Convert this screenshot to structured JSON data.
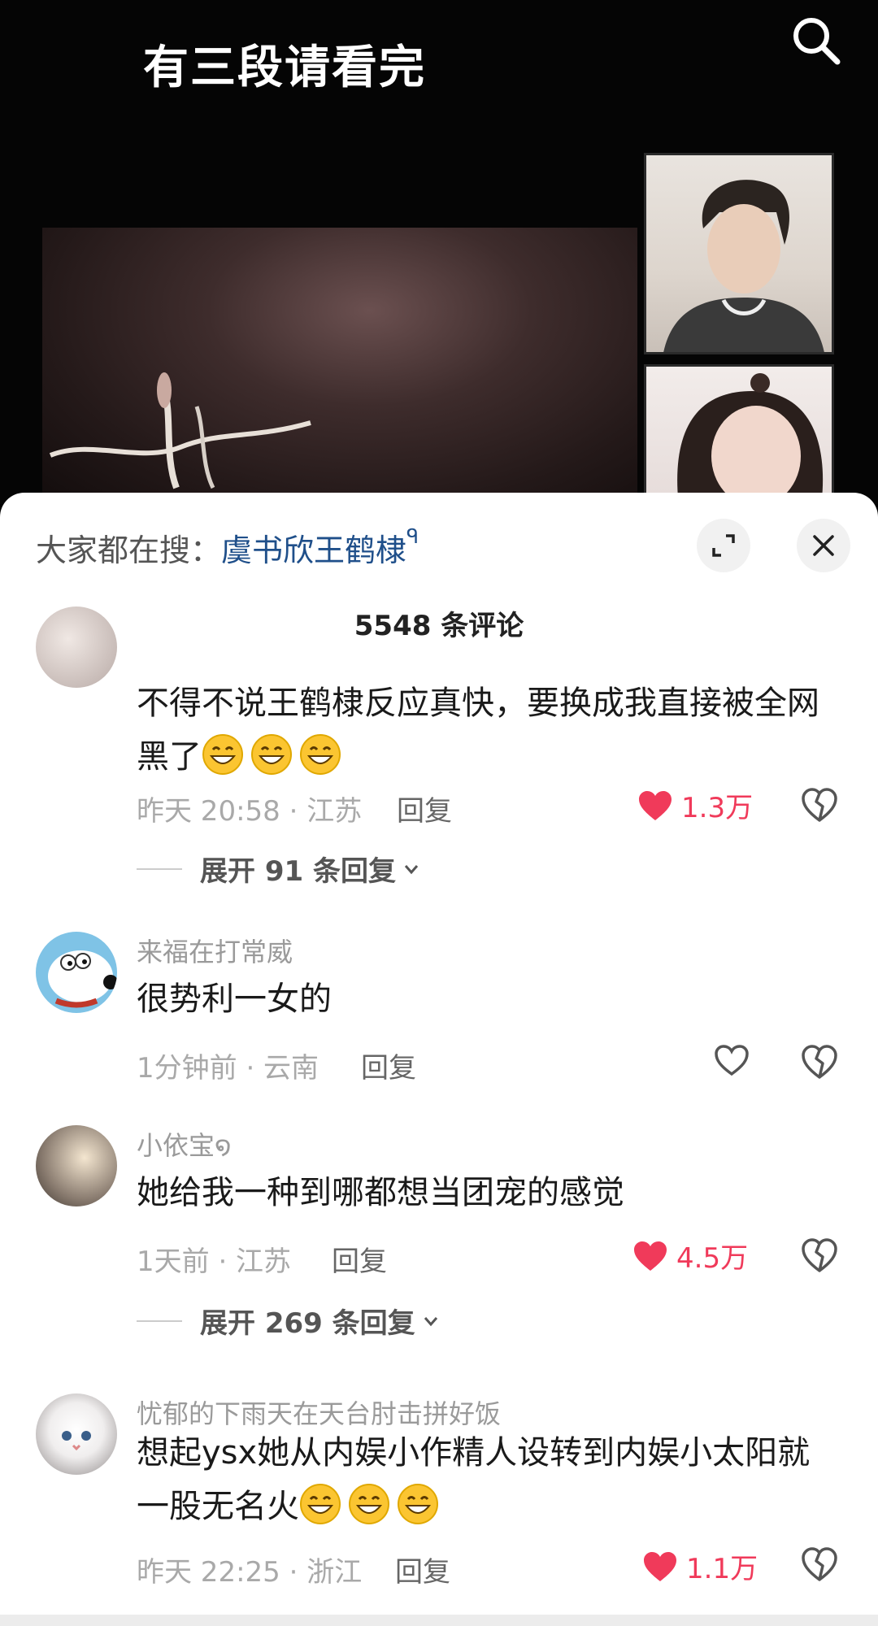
{
  "video": {
    "title": "有三段请看完",
    "search_icon": "search-icon"
  },
  "sheet": {
    "trending_prefix": "大家都在搜：",
    "trending_keyword": "虞书欣王鹤棣",
    "trending_q": "ᑫ",
    "comment_count": "5548 条评论"
  },
  "comments": [
    {
      "text": "不得不说王鹤棣反应真快，要换成我直接被全网黑了",
      "emoji_count": 3,
      "time_location": "昨天 20:58 · 江苏",
      "reply_label": "回复",
      "likes": "1.3万",
      "liked": true,
      "expand_label": "展开 91 条回复"
    },
    {
      "username": "来福在打常威",
      "text": "很势利一女的",
      "time_location": "1分钟前 · 云南",
      "reply_label": "回复",
      "likes": "",
      "liked": false
    },
    {
      "username": "小依宝໑",
      "text": "她给我一种到哪都想当团宠的感觉",
      "time_location": "1天前 · 江苏",
      "reply_label": "回复",
      "likes": "4.5万",
      "liked": true,
      "expand_label": "展开 269 条回复"
    },
    {
      "username": "忧郁的下雨天在天台肘击拼好饭",
      "text": "想起ysx她从内娱小作精人设转到内娱小太阳就一股无名火",
      "emoji_count": 3,
      "time_location": "昨天 22:25 · 浙江",
      "reply_label": "回复",
      "likes": "1.1万",
      "liked": true
    }
  ],
  "colors": {
    "like_red": "#f03a5a",
    "keyword_blue": "#1f4f8a",
    "meta_gray": "#a9a9a9"
  }
}
